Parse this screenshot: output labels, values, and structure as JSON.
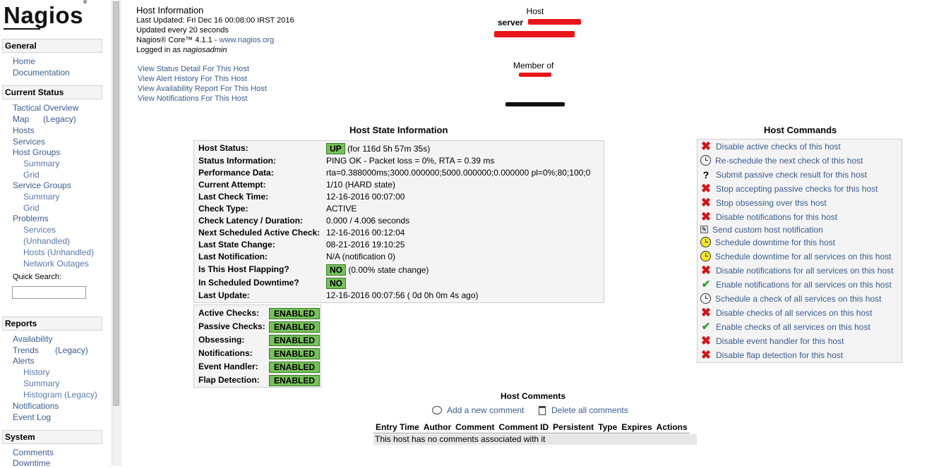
{
  "sidebar": {
    "logo": "Nagios",
    "logo_mark": "®",
    "sections": [
      {
        "title": "General"
      },
      {
        "title": "Current Status"
      },
      {
        "title": "Reports"
      },
      {
        "title": "System"
      }
    ],
    "general": [
      "Home",
      "Documentation"
    ],
    "current_status": {
      "tactical": "Tactical Overview",
      "map": "Map",
      "map_legacy": "(Legacy)",
      "hosts": "Hosts",
      "services": "Services",
      "host_groups": "Host Groups",
      "hg_summary": "Summary",
      "hg_grid": "Grid",
      "service_groups": "Service Groups",
      "sg_summary": "Summary",
      "sg_grid": "Grid",
      "problems": "Problems",
      "p_services": "Services",
      "p_unhandled": "(Unhandled)",
      "p_hosts": "Hosts (Unhandled)",
      "p_outages": "Network Outages"
    },
    "quick_search_label": "Quick Search:",
    "reports": {
      "availability": "Availability",
      "trends": "Trends",
      "trends_legacy": "(Legacy)",
      "alerts": "Alerts",
      "history": "History",
      "summary": "Summary",
      "histogram": "Histogram (Legacy)",
      "notifications": "Notifications",
      "event_log": "Event Log"
    },
    "system": {
      "comments": "Comments",
      "downtime": "Downtime"
    }
  },
  "info": {
    "title": "Host Information",
    "last_updated": "Last Updated: Fri Dec 16 00:08:00 IRST 2016",
    "update_freq": "Updated every 20 seconds",
    "core": "Nagios® Core™ 4.1.1 - ",
    "core_link": "www.nagios.org",
    "logged_in_prefix": "Logged in as ",
    "logged_in_user": "nagiosadmin",
    "links": [
      "View Status Detail For This Host",
      "View Alert History For This Host",
      "View Availability Report For This Host",
      "View Notifications For This Host"
    ]
  },
  "host_header": {
    "host_label": "Host",
    "host_name": "server",
    "member_of": "Member of"
  },
  "state": {
    "title": "Host State Information",
    "rows": [
      {
        "label": "Host Status:",
        "badge": "UP",
        "value": "(for 116d 5h 57m 35s)"
      },
      {
        "label": "Status Information:",
        "value": "PING OK - Packet loss = 0%, RTA = 0.39 ms"
      },
      {
        "label": "Performance Data:",
        "value": "rta=0.388000ms;3000.000000;5000.000000;0.000000 pl=0%;80;100;0"
      },
      {
        "label": "Current Attempt:",
        "value": "1/10  (HARD state)"
      },
      {
        "label": "Last Check Time:",
        "value": "12-16-2016 00:07:00"
      },
      {
        "label": "Check Type:",
        "value": "ACTIVE"
      },
      {
        "label": "Check Latency / Duration:",
        "value": "0.000 / 4.006 seconds"
      },
      {
        "label": "Next Scheduled Active Check:",
        "value": "12-16-2016 00:12:04"
      },
      {
        "label": "Last State Change:",
        "value": "08-21-2016 19:10:25"
      },
      {
        "label": "Last Notification:",
        "value": "N/A (notification 0)"
      },
      {
        "label": "Is This Host Flapping?",
        "badge": "NO",
        "value": "(0.00% state change)"
      },
      {
        "label": "In Scheduled Downtime?",
        "badge": "NO",
        "value": ""
      },
      {
        "label": "Last Update:",
        "value": "12-16-2016 00:07:56  ( 0d 0h 0m 4s ago)"
      }
    ],
    "checks": [
      {
        "label": "Active Checks:",
        "value": "ENABLED"
      },
      {
        "label": "Passive Checks:",
        "value": "ENABLED"
      },
      {
        "label": "Obsessing:",
        "value": "ENABLED"
      },
      {
        "label": "Notifications:",
        "value": "ENABLED"
      },
      {
        "label": "Event Handler:",
        "value": "ENABLED"
      },
      {
        "label": "Flap Detection:",
        "value": "ENABLED"
      }
    ]
  },
  "commands": {
    "title": "Host Commands",
    "items": [
      {
        "icon": "disable-icon",
        "label": "Disable active checks of this host"
      },
      {
        "icon": "clock-icon",
        "label": "Re-schedule the next check of this host"
      },
      {
        "icon": "question-icon",
        "label": "Submit passive check result for this host"
      },
      {
        "icon": "disable-icon",
        "label": "Stop accepting passive checks for this host"
      },
      {
        "icon": "disable-icon",
        "label": "Stop obsessing over this host"
      },
      {
        "icon": "disable-icon",
        "label": "Disable notifications for this host"
      },
      {
        "icon": "notepad-icon",
        "label": "Send custom host notification"
      },
      {
        "icon": "downtime-clock-icon",
        "label": "Schedule downtime for this host"
      },
      {
        "icon": "downtime-clock-icon",
        "label": "Schedule downtime for all services on this host"
      },
      {
        "icon": "disable-icon",
        "label": "Disable notifications for all services on this host"
      },
      {
        "icon": "enable-icon",
        "label": "Enable notifications for all services on this host"
      },
      {
        "icon": "clock-icon",
        "label": "Schedule a check of all services on this host"
      },
      {
        "icon": "disable-icon",
        "label": "Disable checks of all services on this host"
      },
      {
        "icon": "enable-icon",
        "label": "Enable checks of all services on this host"
      },
      {
        "icon": "disable-icon",
        "label": "Disable event handler for this host"
      },
      {
        "icon": "disable-icon",
        "label": "Disable flap detection for this host"
      }
    ]
  },
  "comments": {
    "title": "Host Comments",
    "add": "Add a new comment",
    "delete": "Delete all comments",
    "columns": [
      "Entry Time",
      "Author",
      "Comment",
      "Comment ID",
      "Persistent",
      "Type",
      "Expires",
      "Actions"
    ],
    "empty": "This host has no comments associated with it"
  },
  "colors": {
    "link": "#3b5c8d",
    "badge_green": "#76c05a",
    "disable_red": "#d1161b",
    "enable_green": "#2ea02e",
    "redaction": "#e8151b"
  }
}
